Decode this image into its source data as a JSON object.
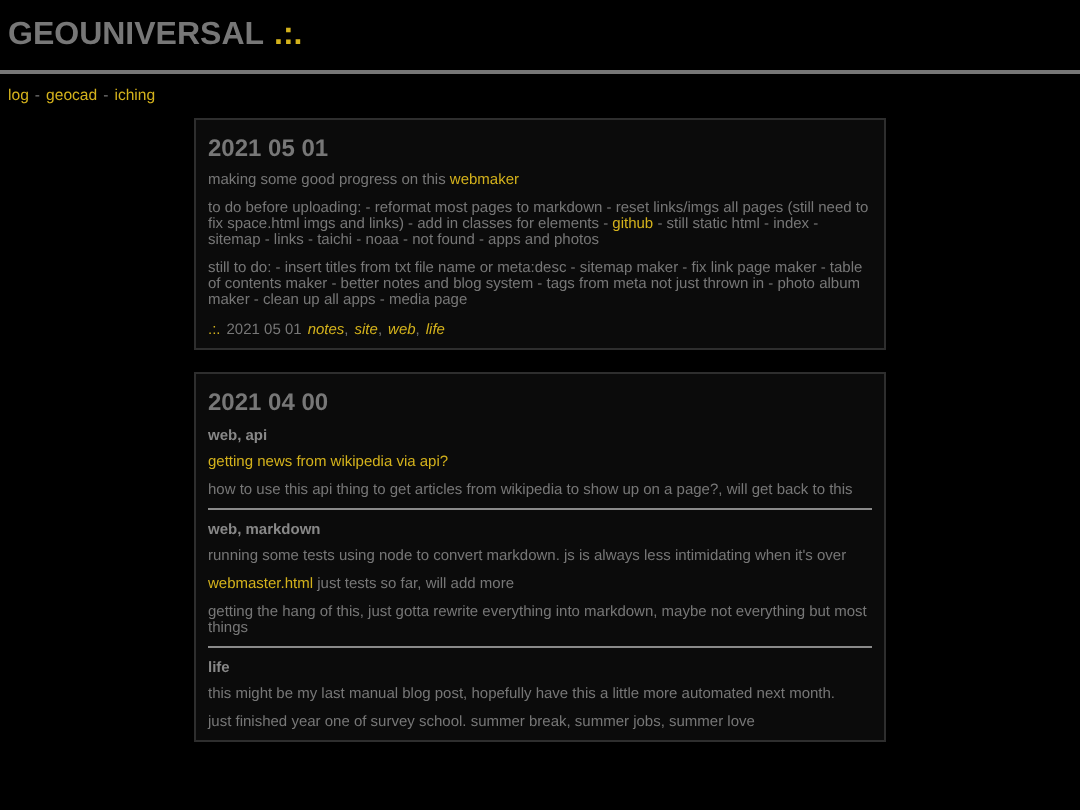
{
  "header": {
    "title": "GEOUNIVERSAL",
    "mark": ".:."
  },
  "nav": {
    "separator": "-",
    "items": [
      {
        "label": "log"
      },
      {
        "label": "geocad"
      },
      {
        "label": "iching"
      }
    ]
  },
  "posts": [
    {
      "date": "2021 05 01",
      "sections": [
        {
          "paragraphs": [
            [
              {
                "kind": "text",
                "text": "making some good progress on this"
              },
              {
                "kind": "link",
                "text": "webmaker"
              }
            ],
            [
              {
                "kind": "text",
                "text": "to do before uploading: - reformat most pages to markdown - reset links/imgs all pages (still need to fix space.html imgs and links) - add in classes for elements -"
              },
              {
                "kind": "link",
                "text": "github"
              },
              {
                "kind": "text",
                "text": "- still static html - index - sitemap - links - taichi - noaa - not found - apps and photos"
              }
            ],
            [
              {
                "kind": "text",
                "text": "still to do: - insert titles from txt file name or meta:desc - sitemap maker - fix link page maker - table of contents maker - better notes and blog system - tags from meta not just thrown in - photo album maker - clean up all apps - media page"
              }
            ]
          ]
        }
      ],
      "footer": {
        "mark": ".:.",
        "date": "2021 05 01",
        "tag_separator": ",",
        "tags": [
          "notes",
          "site",
          "web",
          "life"
        ]
      }
    },
    {
      "date": "2021 04 00",
      "sections": [
        {
          "heading": "web, api",
          "paragraphs": [
            [
              {
                "kind": "link",
                "text": "getting news from wikipedia via api?"
              }
            ],
            [
              {
                "kind": "text",
                "text": "how to use this api thing to get articles from wikipedia to show up on a page?, will get back to this"
              }
            ]
          ]
        },
        {
          "heading": "web, markdown",
          "paragraphs": [
            [
              {
                "kind": "text",
                "text": "running some tests using node to convert markdown. js is always less intimidating when it's over"
              }
            ],
            [
              {
                "kind": "link",
                "text": "webmaster.html"
              },
              {
                "kind": "text",
                "text": "just tests so far, will add more"
              }
            ],
            [
              {
                "kind": "text",
                "text": "getting the hang of this, just gotta rewrite everything into markdown, maybe not everything but most things"
              }
            ]
          ]
        },
        {
          "heading": "life",
          "paragraphs": [
            [
              {
                "kind": "text",
                "text": "this might be my last manual blog post, hopefully have this a little more automated next month."
              }
            ],
            [
              {
                "kind": "text",
                "text": "just finished year one of survey school. summer break, summer jobs, summer love"
              }
            ]
          ]
        }
      ]
    }
  ]
}
